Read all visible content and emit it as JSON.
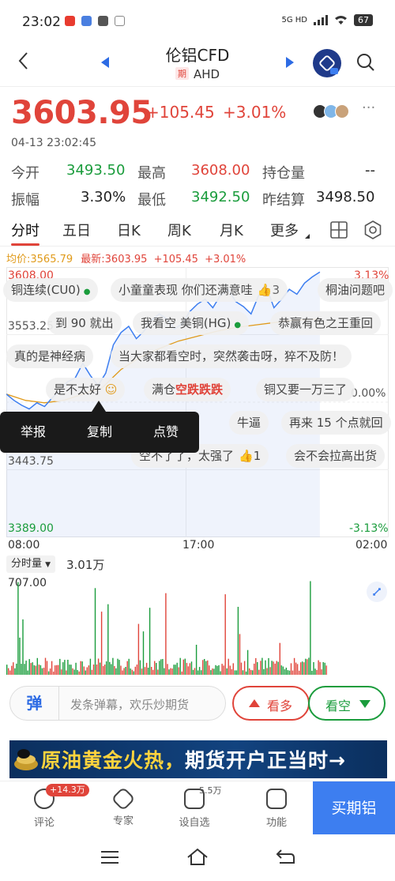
{
  "status": {
    "time": "23:02",
    "network_top": "5G HD",
    "battery": "67"
  },
  "header": {
    "title": "伦铝CFD",
    "qi_tag": "期",
    "code": "AHD"
  },
  "quote": {
    "price": "3603.95",
    "change": "+105.45",
    "change_pct": "+3.01%",
    "timestamp": "04-13 23:02:45"
  },
  "stats": {
    "open_label": "今开",
    "open": "3493.50",
    "high_label": "最高",
    "high": "3608.00",
    "oi_label": "持仓量",
    "oi": "--",
    "amp_label": "振幅",
    "amp": "3.30%",
    "low_label": "最低",
    "low": "3492.50",
    "prev_label": "昨结算",
    "prev": "3498.50"
  },
  "tabs": [
    "分时",
    "五日",
    "日K",
    "周K",
    "月K",
    "更多"
  ],
  "chart_info": {
    "avg": "均价:3565.79",
    "latest": "最新:3603.95",
    "change": "+105.45",
    "pct": "+3.01%"
  },
  "chart_data": {
    "type": "line",
    "title": "",
    "x_ticks": [
      "08:00",
      "17:00",
      "02:00"
    ],
    "y_ticks_left": [
      "3608.00",
      "3553.25",
      "3443.75",
      "3389.00"
    ],
    "y_ticks_right": [
      "3.13%",
      "0.00%",
      "-3.13%"
    ],
    "ylim": [
      3389.0,
      3608.0
    ],
    "series": [
      {
        "x": [
          0,
          0.02,
          0.04,
          0.06,
          0.08,
          0.1,
          0.12,
          0.14,
          0.16,
          0.18,
          0.2,
          0.22,
          0.24,
          0.26,
          0.28,
          0.3,
          0.32,
          0.34,
          0.36,
          0.38,
          0.4,
          0.42,
          0.44,
          0.46,
          0.48,
          0.5,
          0.52,
          0.54,
          0.56,
          0.58,
          0.6,
          0.62,
          0.64,
          0.66,
          0.68,
          0.7,
          0.72,
          0.74,
          0.76,
          0.78,
          0.8,
          0.82
        ],
        "values": [
          3505,
          3500,
          3496,
          3493,
          3498,
          3495,
          3502,
          3508,
          3515,
          3518,
          3530,
          3520,
          3512,
          3522,
          3545,
          3555,
          3560,
          3550,
          3556,
          3565,
          3570,
          3566,
          3558,
          3562,
          3572,
          3578,
          3582,
          3575,
          3585,
          3590,
          3580,
          3576,
          3570,
          3585,
          3592,
          3575,
          3582,
          3590,
          3586,
          3595,
          3600,
          3604
        ]
      },
      {
        "x": [
          0,
          0.05,
          0.1,
          0.15,
          0.2,
          0.25,
          0.3,
          0.35,
          0.4,
          0.45,
          0.5,
          0.55,
          0.6,
          0.65,
          0.7,
          0.75,
          0.82
        ],
        "values": [
          3505,
          3500,
          3498,
          3500,
          3505,
          3510,
          3525,
          3535,
          3542,
          3548,
          3552,
          3556,
          3559,
          3561,
          3563,
          3565,
          3566
        ]
      }
    ]
  },
  "danmu": [
    {
      "text": "铜连续(CU0)"
    },
    {
      "text": "小童童表现 你们还满意哇",
      "likes": "3"
    },
    {
      "text": "桐油问题吧"
    },
    {
      "text": "到 90 就出"
    },
    {
      "text": "我看空 美铜(HG)"
    },
    {
      "text": "恭赢有色之王重回"
    },
    {
      "text": "真的是神经病"
    },
    {
      "text": "当大家都看空时，突然袭击呀，猝不及防！"
    },
    {
      "text": "满仓",
      "hl": "空跌跌跌"
    },
    {
      "text": "铜又要一万三了"
    },
    {
      "text": "牛逼"
    },
    {
      "text": "再来 15 个点就回"
    },
    {
      "text": "是不太好"
    },
    {
      "text": "空不了了，太强了",
      "likes": "1"
    },
    {
      "text": "会不会拉高出货"
    }
  ],
  "context_menu": [
    "举报",
    "复制",
    "点赞"
  ],
  "volume": {
    "selector": "分时量",
    "value": "3.01万",
    "max": "707.00"
  },
  "input_bar": {
    "toggle": "弹",
    "placeholder": "发条弹幕，欢乐炒期货",
    "bull": "看多",
    "bear": "看空"
  },
  "banner": {
    "text_part1": "原油黄金火热，",
    "text_part2": "期货开户正当时→"
  },
  "bottom_bar": {
    "comment_badge": "+14.3万",
    "comment": "评论",
    "expert": "专家",
    "watch_badge": "5.5万",
    "watch": "设自选",
    "function": "功能",
    "buy": "买期铝"
  },
  "colors": {
    "up": "#e0443a",
    "down": "#1a9c3c",
    "accent": "#3d7ef0",
    "avg_line": "#e09a1a"
  }
}
